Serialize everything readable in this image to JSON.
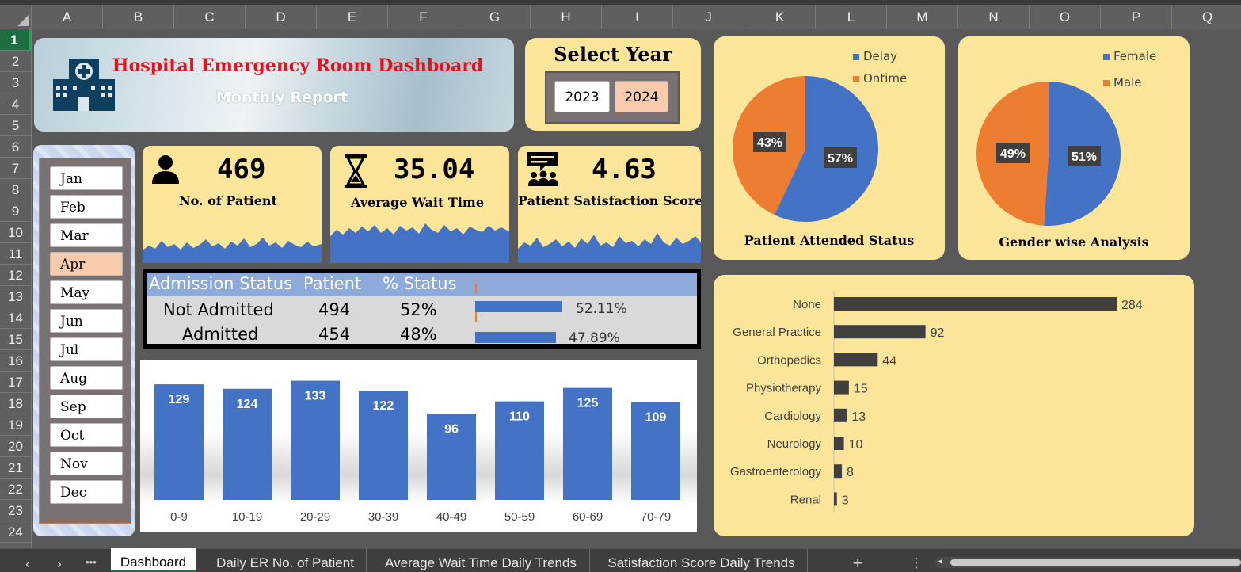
{
  "columns": [
    "A",
    "B",
    "C",
    "D",
    "E",
    "F",
    "G",
    "H",
    "I",
    "J",
    "K",
    "L",
    "M",
    "N",
    "O",
    "P",
    "Q"
  ],
  "rows": [
    "1",
    "2",
    "3",
    "4",
    "5",
    "6",
    "7",
    "8",
    "9",
    "10",
    "11",
    "12",
    "13",
    "14",
    "15",
    "16",
    "17",
    "18",
    "19",
    "20",
    "21",
    "22",
    "23",
    "24"
  ],
  "selected_row": "1",
  "banner": {
    "title": "Hospital Emergency Room Dashboard",
    "subtitle": "Monthly Report",
    "icon": "hospital-building-icon"
  },
  "year_selector": {
    "title": "Select Year",
    "years": [
      "2023",
      "2024"
    ],
    "selected": "2024"
  },
  "months": {
    "items": [
      "Jan",
      "Feb",
      "Mar",
      "Apr",
      "May",
      "Jun",
      "Jul",
      "Aug",
      "Sep",
      "Oct",
      "Nov",
      "Dec"
    ],
    "selected": "Apr"
  },
  "kpis": [
    {
      "value": "469",
      "label": "No. of Patient",
      "icon": "person-icon"
    },
    {
      "value": "35.04",
      "label": "Average Wait Time",
      "icon": "hourglass-icon"
    },
    {
      "value": "4.63",
      "label": "Patient Satisfaction Score",
      "icon": "feedback-group-icon"
    }
  ],
  "admission": {
    "headers": [
      "Admission Status",
      "Patient",
      "% Status"
    ],
    "rows": [
      {
        "status": "Not Admitted",
        "patient": "494",
        "pct": "52%",
        "bar_label": "52.11%",
        "bar_value": 52.11
      },
      {
        "status": "Admitted",
        "patient": "454",
        "pct": "48%",
        "bar_label": "47.89%",
        "bar_value": 47.89
      }
    ]
  },
  "colors": {
    "blue": "#4472c4",
    "orange": "#ed7d31",
    "panel": "#fde59a",
    "dark_bar": "#404040",
    "title_red": "#e8101c"
  },
  "chart_data": [
    {
      "type": "bar",
      "categories": [
        "0-9",
        "10-19",
        "20-29",
        "30-39",
        "40-49",
        "50-59",
        "60-69",
        "70-79"
      ],
      "values": [
        129,
        124,
        133,
        122,
        96,
        110,
        125,
        109
      ],
      "title": "",
      "xlabel": "",
      "ylabel": "",
      "ylim": [
        0,
        145
      ]
    },
    {
      "type": "pie",
      "title": "Patient Attended Status",
      "labels": [
        "Delay",
        "Ontime"
      ],
      "values": [
        57,
        43
      ],
      "data_labels": [
        "57%",
        "43%"
      ],
      "colors": [
        "#4472c4",
        "#ed7d31"
      ],
      "legend": "top-right"
    },
    {
      "type": "pie",
      "title": "Gender wise Analysis",
      "labels": [
        "Female",
        "Male"
      ],
      "values": [
        51,
        49
      ],
      "data_labels": [
        "51%",
        "49%"
      ],
      "colors": [
        "#4472c4",
        "#ed7d31"
      ],
      "legend": "top-right"
    },
    {
      "type": "bar",
      "orientation": "horizontal",
      "categories": [
        "None",
        "General Practice",
        "Orthopedics",
        "Physiotherapy",
        "Cardiology",
        "Neurology",
        "Gastroenterology",
        "Renal"
      ],
      "values": [
        284,
        92,
        44,
        15,
        13,
        10,
        8,
        3
      ],
      "title": "",
      "xlabel": "",
      "ylabel": "",
      "xlim": [
        0,
        284
      ]
    }
  ],
  "tabs": {
    "items": [
      "Dashboard",
      "Daily ER No. of Patient",
      "Average Wait Time Daily Trends",
      "Satisfaction Score Daily Trends"
    ],
    "active": "Dashboard",
    "more": "•••",
    "add": "+",
    "options": "⋮"
  }
}
